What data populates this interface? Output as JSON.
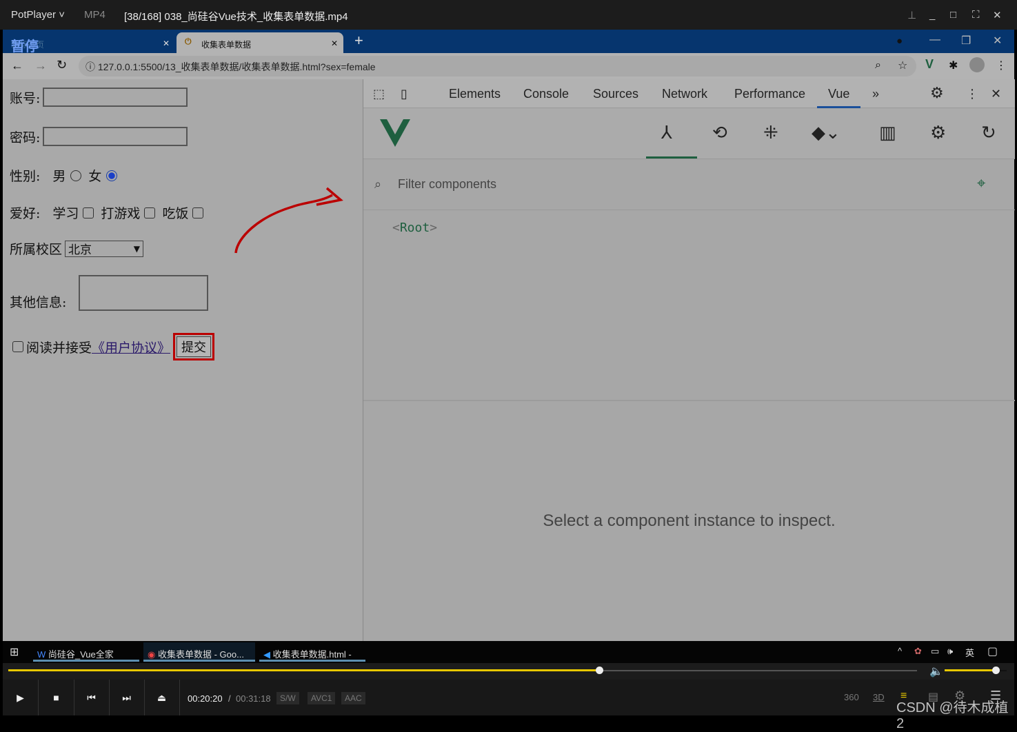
{
  "player": {
    "app": "PotPlayer",
    "format": "MP4",
    "title": "[38/168] 038_尚硅谷Vue技术_收集表单数据.mp4",
    "paused_label": "暂停",
    "time_current": "00:20:20",
    "time_sep": "/",
    "time_total": "00:31:18",
    "badges": [
      "S/W",
      "AVC1",
      "AAC"
    ],
    "progress_percent": 65,
    "volume_percent": 82,
    "right_icons": [
      "360",
      "3D"
    ],
    "watermark": "CSDN @待木成植2"
  },
  "browser": {
    "tabs": [
      {
        "label": "新标签页"
      },
      {
        "label": "收集表单数据"
      }
    ],
    "new_tab": "+",
    "url": "127.0.0.1:5500/13_收集表单数据/收集表单数据.html?sex=female"
  },
  "form": {
    "account_label": "账号:",
    "password_label": "密码:",
    "gender_label": "性别:",
    "gender_options": [
      "男",
      "女"
    ],
    "gender_selected": "女",
    "hobby_label": "爱好:",
    "hobbies": [
      "学习",
      "打游戏",
      "吃饭"
    ],
    "campus_label": "所属校区",
    "campus_value": "北京",
    "other_label": "其他信息:",
    "agree_text": "阅读并接受",
    "agreement_link": "《用户协议》",
    "submit": "提交"
  },
  "devtools": {
    "tabs": [
      "Elements",
      "Console",
      "Sources",
      "Network",
      "Performance",
      "Vue"
    ],
    "active_tab": "Vue",
    "more": "»",
    "filter_placeholder": "Filter components",
    "root": "Root",
    "inspect_msg": "Select a component instance to inspect.",
    "vue_color": "#1e5f3f"
  },
  "taskbar": {
    "items": [
      "尚硅谷_Vue全家桶.d...",
      "收集表单数据 - Goo...",
      "收集表单数据.html - ..."
    ],
    "ime": "英"
  }
}
